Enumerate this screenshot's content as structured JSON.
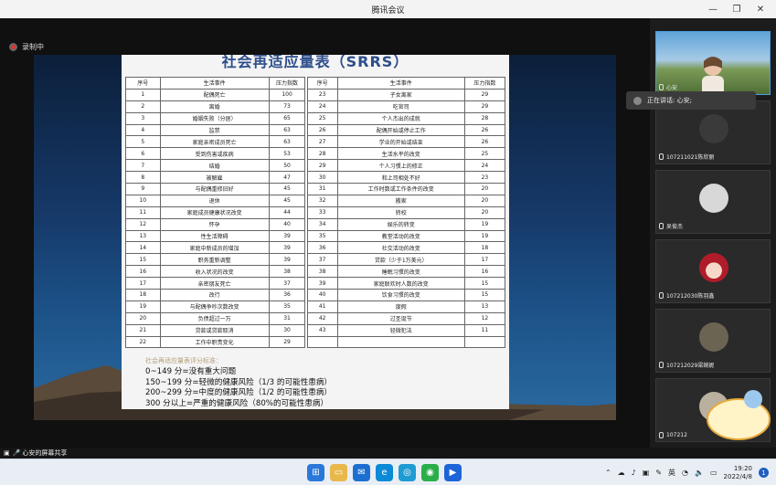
{
  "window": {
    "title": "腾讯会议"
  },
  "recording": {
    "label": "录制中"
  },
  "slide": {
    "title": "社会再适应量表（SRRS）",
    "headers": [
      "序号",
      "生活事件",
      "压力指数"
    ],
    "left": [
      [
        "1",
        "配偶死亡",
        "100"
      ],
      [
        "2",
        "离婚",
        "73"
      ],
      [
        "3",
        "婚姻失败（分居）",
        "65"
      ],
      [
        "4",
        "监禁",
        "63"
      ],
      [
        "5",
        "家庭亲密成员死亡",
        "63"
      ],
      [
        "6",
        "受到伤害或疾病",
        "53"
      ],
      [
        "7",
        "结婚",
        "50"
      ],
      [
        "8",
        "被解雇",
        "47"
      ],
      [
        "9",
        "与配偶重修旧好",
        "45"
      ],
      [
        "10",
        "退休",
        "45"
      ],
      [
        "11",
        "家庭成员健康状况改变",
        "44"
      ],
      [
        "12",
        "怀孕",
        "40"
      ],
      [
        "13",
        "性生活障碍",
        "39"
      ],
      [
        "14",
        "家庭中新成员的增加",
        "39"
      ],
      [
        "15",
        "职务重新调整",
        "39"
      ],
      [
        "16",
        "收入状况的改变",
        "38"
      ],
      [
        "17",
        "亲密朋友死亡",
        "37"
      ],
      [
        "18",
        "改行",
        "36"
      ],
      [
        "19",
        "与配偶争吵次数改变",
        "35"
      ],
      [
        "20",
        "负债超过一万",
        "31"
      ],
      [
        "21",
        "贷款或贷款取消",
        "30"
      ],
      [
        "22",
        "工作中职责变化",
        "29"
      ]
    ],
    "right": [
      [
        "23",
        "子女离家",
        "29"
      ],
      [
        "24",
        "吃官司",
        "29"
      ],
      [
        "25",
        "个人杰出的成就",
        "28"
      ],
      [
        "26",
        "配偶开始或停止工作",
        "26"
      ],
      [
        "27",
        "学业的开始或结束",
        "26"
      ],
      [
        "28",
        "生活水平的改变",
        "25"
      ],
      [
        "29",
        "个人习惯上的修正",
        "24"
      ],
      [
        "30",
        "和上司相处不好",
        "23"
      ],
      [
        "31",
        "工作时数或工作条件的改变",
        "20"
      ],
      [
        "32",
        "搬家",
        "20"
      ],
      [
        "33",
        "转校",
        "20"
      ],
      [
        "34",
        "娱乐的转变",
        "19"
      ],
      [
        "35",
        "教堂活动的改变",
        "19"
      ],
      [
        "36",
        "社交活动的改变",
        "18"
      ],
      [
        "37",
        "贷款（少于1万美元）",
        "17"
      ],
      [
        "38",
        "睡眠习惯的改变",
        "16"
      ],
      [
        "39",
        "家庭联欢时人数的改变",
        "15"
      ],
      [
        "40",
        "饮食习惯的改变",
        "15"
      ],
      [
        "41",
        "度假",
        "13"
      ],
      [
        "42",
        "过圣诞节",
        "12"
      ],
      [
        "43",
        "轻微犯法",
        "11"
      ]
    ],
    "criteria_head": "社会再适应量表评分标准：",
    "criteria": [
      "0~149 分=没有重大问题",
      "150~199 分=轻微的健康风险（1/3 的可能性患病）",
      "200~299 分=中度的健康风险（1/2 的可能性患病）",
      "300 分以上=严重的健康风险（80%的可能性患病）"
    ]
  },
  "speaking": {
    "label": "正在讲话: 心安;"
  },
  "participants": [
    {
      "name": "心安"
    },
    {
      "name": "107211021陈欣丽"
    },
    {
      "name": "吴俊杰"
    },
    {
      "name": "107212030陈羽鑫"
    },
    {
      "name": "107212029梁婉妮"
    },
    {
      "name": "107212"
    }
  ],
  "sharebar": {
    "label": "心安的屏幕共享"
  },
  "taskbar": {
    "lang": "英",
    "time": "19:20",
    "date": "2022/4/8",
    "notifications": "1"
  }
}
